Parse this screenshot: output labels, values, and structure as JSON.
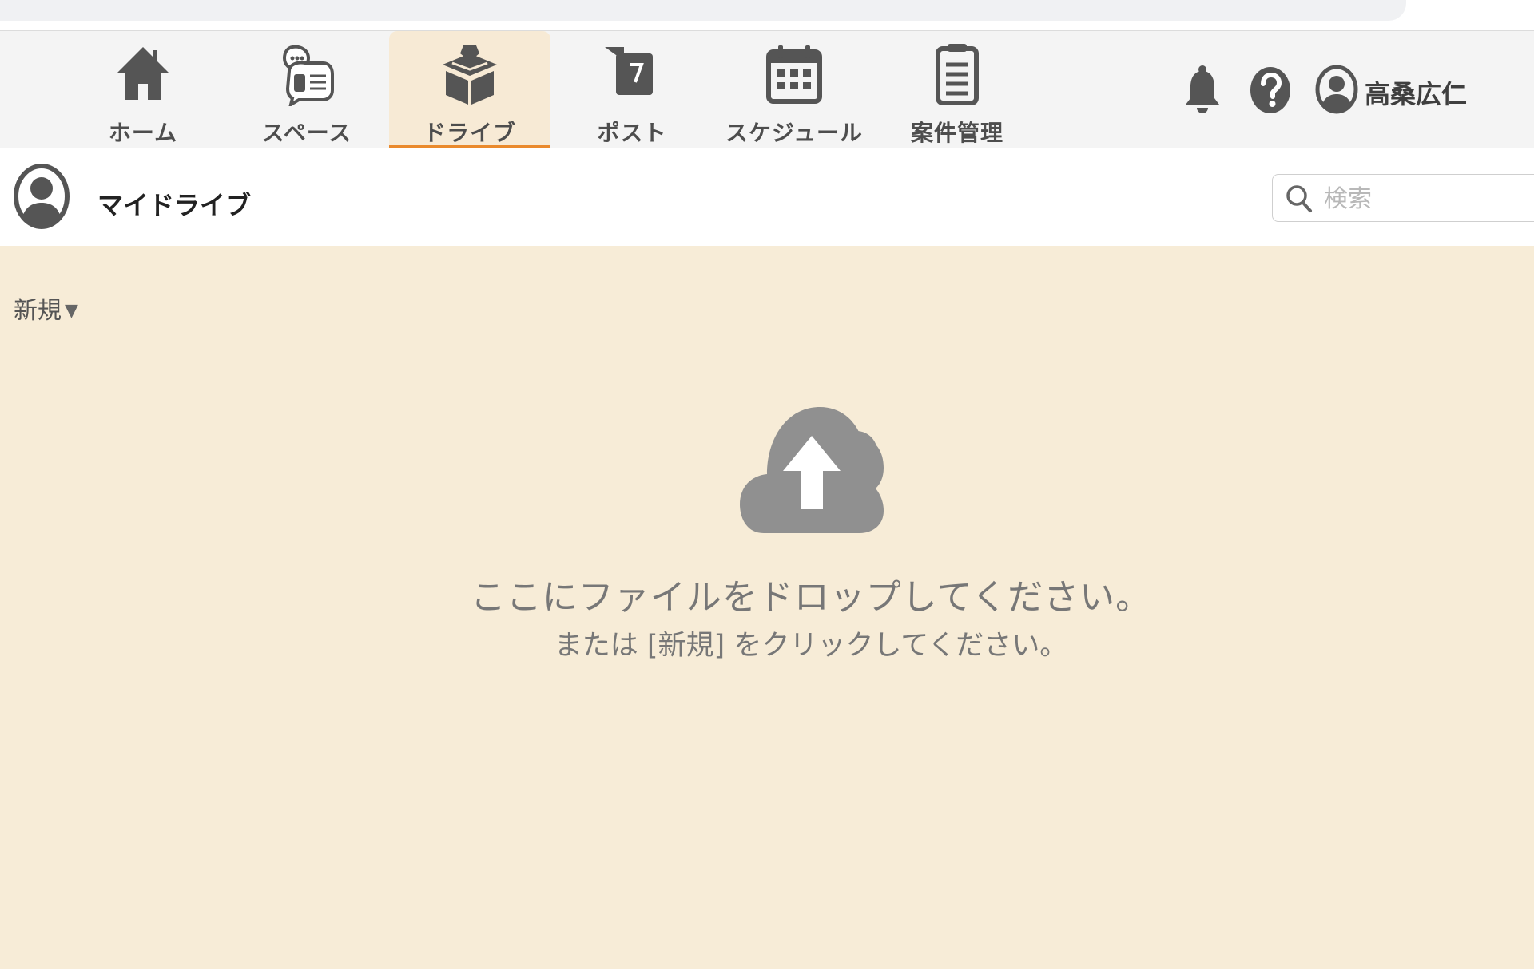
{
  "nav": {
    "items": [
      {
        "label": "ホーム",
        "icon": "home-icon"
      },
      {
        "label": "スペース",
        "icon": "space-chat-icon"
      },
      {
        "label": "ドライブ",
        "icon": "drive-box-icon",
        "active": true
      },
      {
        "label": "ポスト",
        "icon": "post-icon"
      },
      {
        "label": "スケジュール",
        "icon": "calendar-icon"
      },
      {
        "label": "案件管理",
        "icon": "clipboard-icon"
      }
    ],
    "active_color": "#ea8a2c"
  },
  "header": {
    "notification_icon": "bell-icon",
    "help_icon": "help-icon",
    "user_name": "高桑広仁"
  },
  "drive": {
    "title": "マイドライブ"
  },
  "search": {
    "placeholder": "検索"
  },
  "toolbar": {
    "new_label": "新規"
  },
  "dropzone": {
    "icon": "cloud-upload-icon",
    "title": "ここにファイルをドロップしてください。",
    "subtitle": "または [新規] をクリックしてください。"
  },
  "colors": {
    "main_background": "#f7ecd7",
    "icon_gray": "#555555"
  }
}
